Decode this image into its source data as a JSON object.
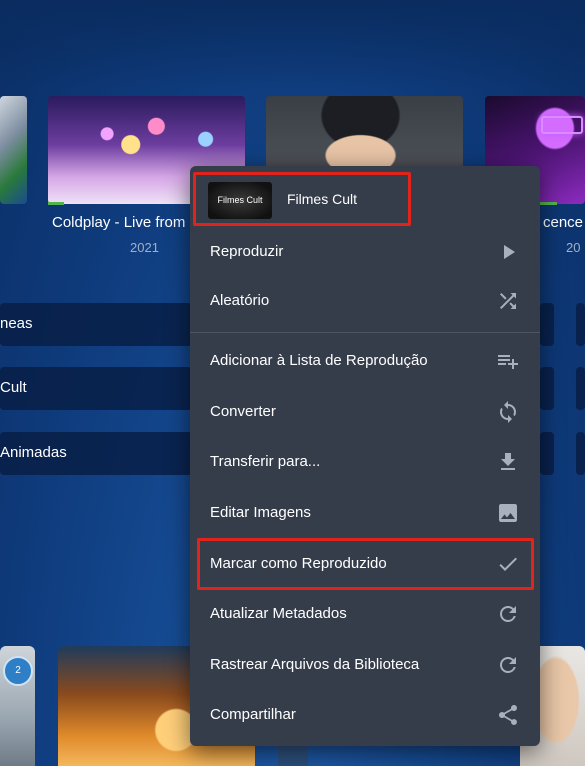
{
  "colors": {
    "accent_green": "#52b54b",
    "highlight_red": "#e0241b",
    "menu_bg": "#353d4b"
  },
  "posters": [
    {
      "title": "Coldplay - Live from",
      "year": "2021"
    },
    {
      "title": "cence",
      "year": "20"
    }
  ],
  "left_rows": [
    {
      "label": "neas"
    },
    {
      "label": "Cult"
    },
    {
      "label": "Animadas"
    }
  ],
  "bottom_badge": {
    "text": "2"
  },
  "menu": {
    "header": {
      "thumb_text": "Filmes Cult",
      "title": "Filmes Cult"
    },
    "items": [
      {
        "label": "Reproduzir",
        "icon": "play-icon"
      },
      {
        "label": "Aleatório",
        "icon": "shuffle-icon"
      },
      {
        "label": "Adicionar à Lista de Reprodução",
        "icon": "playlist-add-icon"
      },
      {
        "label": "Converter",
        "icon": "sync-icon"
      },
      {
        "label": "Transferir para...",
        "icon": "download-icon"
      },
      {
        "label": "Editar Imagens",
        "icon": "image-icon"
      },
      {
        "label": "Marcar como Reproduzido",
        "icon": "check-icon"
      },
      {
        "label": "Atualizar Metadados",
        "icon": "refresh-icon"
      },
      {
        "label": "Rastrear Arquivos da Biblioteca",
        "icon": "refresh-icon"
      },
      {
        "label": "Compartilhar",
        "icon": "share-icon"
      }
    ]
  }
}
